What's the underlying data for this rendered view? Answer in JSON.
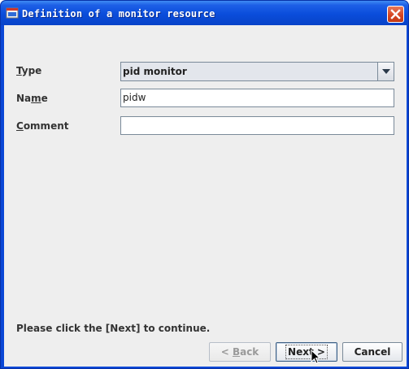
{
  "window": {
    "title": "Definition of a monitor resource"
  },
  "form": {
    "type": {
      "label_mnemonic": "T",
      "label_rest": "ype",
      "value": "pid monitor"
    },
    "name": {
      "label_before": "Na",
      "label_mnemonic": "m",
      "label_after": "e",
      "value": "pidw"
    },
    "comment": {
      "label_mnemonic": "C",
      "label_rest": "omment",
      "value": ""
    }
  },
  "hint": "Please click the [Next] to continue.",
  "buttons": {
    "back": {
      "prefix": "< ",
      "mnemonic": "B",
      "rest": "ack",
      "enabled": false
    },
    "next": {
      "label": "Next >",
      "focused": true
    },
    "cancel": {
      "label": "Cancel"
    }
  },
  "icons": [
    "app-icon",
    "close-icon",
    "chevron-down-icon",
    "mouse-pointer-icon"
  ]
}
